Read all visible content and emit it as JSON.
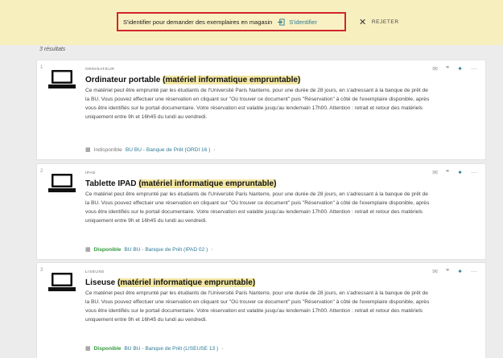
{
  "banner": {
    "signin_prompt": "S'identifier pour demander des exemplaires en magasin",
    "signin_link": "S'identifier",
    "reject_label": "REJETER"
  },
  "results_count": "3 résultats",
  "results": [
    {
      "number": "1",
      "type": "ORDINATEUR",
      "title_main": "Ordinateur portable",
      "title_paren": "(matériel informatique empruntable)",
      "description": "Ce matériel peut être emprunté par les étudiants de l'Université Paris Nanterre, pour une durée de 28 jours, en s'adressant à la banque de prêt de la BU. Vous pouvez effectuer une réservation en cliquant sur \"Où trouver ce document\" puis \"Réservation\" à côté de l'exemplaire disponible, après vous être identifiés sur le portail documentaire. Votre réservation est valable jusqu'au lendemain 17h00. Attention : retrait et retour des matériels uniquement entre 9h et 16h45 du lundi au vendredi.",
      "status": "Indisponible",
      "location": "BU  BU - Banque de Prêt (ORDI 16 )"
    },
    {
      "number": "2",
      "type": "IPAD",
      "title_main": "Tablette IPAD",
      "title_paren": "(matériel informatique empruntable)",
      "description": "Ce matériel peut être emprunté par les étudiants de l'Université Paris Nanterre, pour une durée de 28 jours, en s'adressant à la banque de prêt de la BU. Vous pouvez effectuer une réservation en cliquant sur \"Où trouver ce document\" puis \"Réservation\" à côté de l'exemplaire disponible, après vous être identifiés sur le portail documentaire. Votre réservation est valable jusqu'au lendemain 17h00. Attention : retrait et retour des matériels uniquement entre 9h et 16h45 du lundi au vendredi.",
      "status": "Disponible",
      "location": "BU  BU - Banque de Prêt (IPAD 02 )"
    },
    {
      "number": "3",
      "type": "LISEUSE",
      "title_main": "Liseuse",
      "title_paren": "(matériel informatique empruntable)",
      "description": "Ce matériel peut être emprunté par les étudiants de l'Université Paris Nanterre, pour une durée de 28 jours, en s'adressant à la banque de prêt de la BU. Vous pouvez effectuer une réservation en cliquant sur \"Où trouver ce document\" puis \"Réservation\" à côté de l'exemplaire disponible, après vous être identifiés sur le portail documentaire. Votre réservation est valable jusqu'au lendemain 17h00. Attention : retrait et retour des matériels uniquement entre 9h et 16h45 du lundi au vendredi.",
      "status": "Disponible",
      "location": "BU  BU - Banque de Prêt (LISEUSE 13 )"
    }
  ],
  "icons": {
    "email": "email-icon",
    "citation": "quote-icon",
    "pin": "pin-icon",
    "more": "more-icon",
    "device": "laptop-icon",
    "signin": "sign-in-icon",
    "close": "close-icon"
  },
  "colors": {
    "banner_bg": "#f8efbf",
    "highlight_border": "#d0262b",
    "link": "#2c7a96",
    "available": "#2f9a3a",
    "unavailable": "#777777",
    "title_highlight": "#f3e7a3"
  }
}
